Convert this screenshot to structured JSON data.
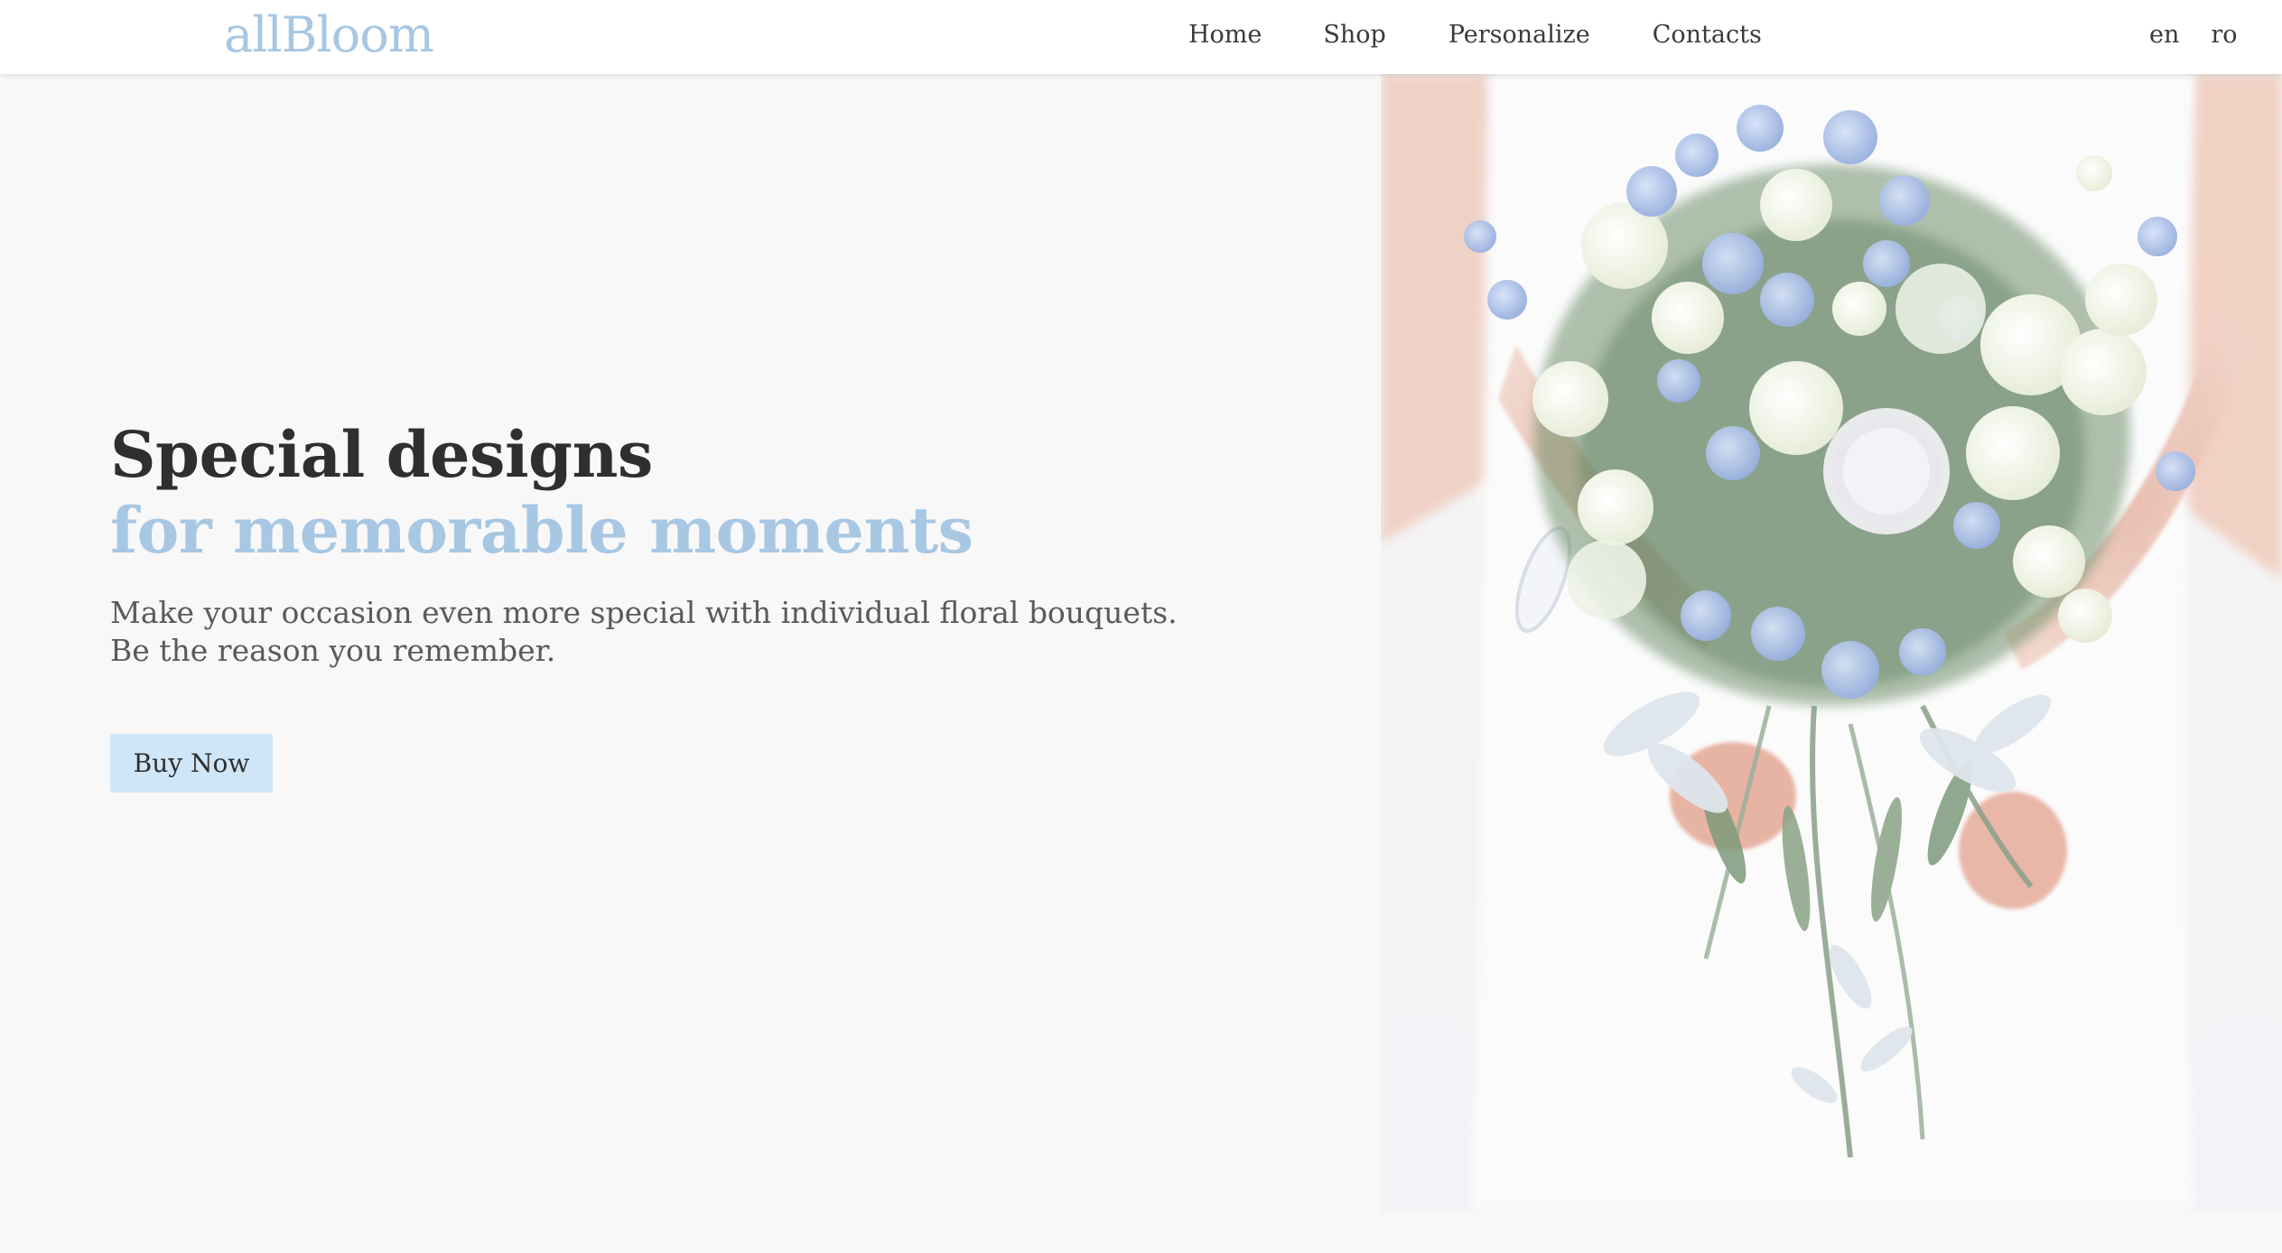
{
  "header": {
    "logo": "allBloom",
    "nav": [
      {
        "label": "Home"
      },
      {
        "label": "Shop"
      },
      {
        "label": "Personalize"
      },
      {
        "label": "Contacts"
      }
    ],
    "languages": [
      {
        "label": "en"
      },
      {
        "label": "ro"
      }
    ]
  },
  "hero": {
    "title_line1": "Special designs",
    "title_line2": "for memorable moments",
    "subtitle_line1": "Make your occasion even more special with individual floral bouquets.",
    "subtitle_line2": "Be the reason you remember.",
    "cta_label": "Buy Now"
  },
  "colors": {
    "accent": "#a7c7e3",
    "button_bg": "#cfe6f8",
    "text_dark": "#2f2f2f",
    "text_muted": "#5a5a5a",
    "page_bg": "#f8f8f8",
    "header_bg": "#ffffff"
  },
  "images": {
    "hero_photo": "bridal-bouquet-photo"
  }
}
